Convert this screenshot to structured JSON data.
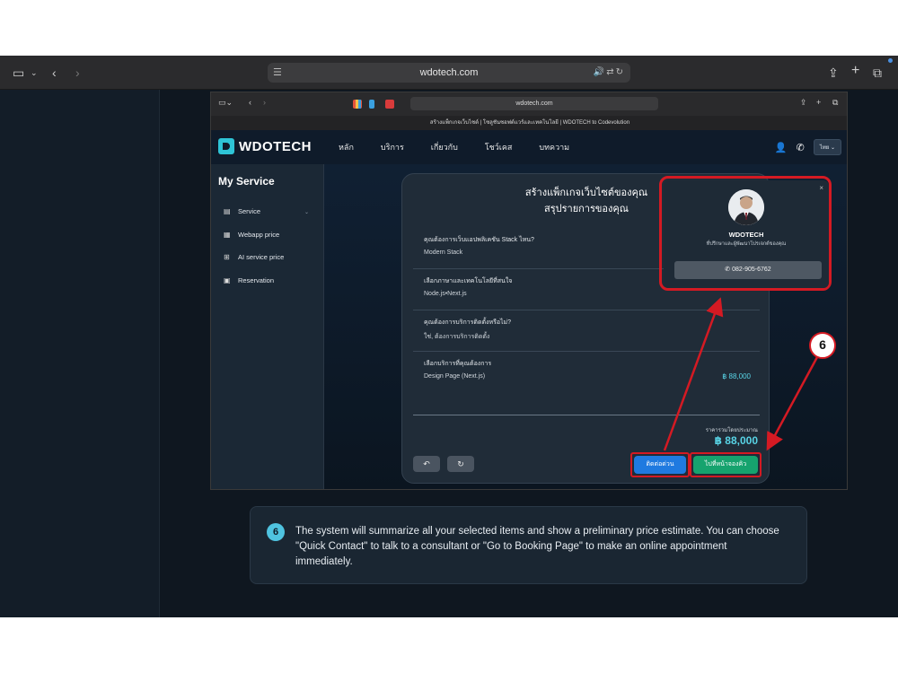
{
  "outer_browser": {
    "url": "wdotech.com"
  },
  "inner_browser": {
    "url": "wdotech.com",
    "tab_title": "สร้างแพ็กเกจเว็บไซต์ | โซลูชันซอฟต์แวร์และเทคโนโลยี | WDOTECH to Codevolution"
  },
  "site": {
    "logo_text": "WDOTECH",
    "nav": [
      "หลัก",
      "บริการ",
      "เกี่ยวกับ",
      "โชว์เคส",
      "บทความ"
    ],
    "lang": "ไทย ⌄"
  },
  "sidebar": {
    "title": "My Service",
    "items": [
      {
        "icon": "server-icon",
        "label": "Service"
      },
      {
        "icon": "document-icon",
        "label": "Webapp price"
      },
      {
        "icon": "chip-icon",
        "label": "AI service price"
      },
      {
        "icon": "calendar-icon",
        "label": "Reservation"
      }
    ]
  },
  "summary": {
    "title_line1": "สร้างแพ็กเกจเว็บไซต์ของคุณ",
    "title_line2": "สรุปรายการของคุณ",
    "rows": [
      {
        "question": "คุณต้องการเว็บแอปพลิเคชัน Stack ไหน?",
        "answer": "Modern Stack",
        "price": ""
      },
      {
        "question": "เลือกภาษาและเทคโนโลยีที่สนใจ",
        "answer": "Node.js•Next.js",
        "price": ""
      },
      {
        "question": "คุณต้องการบริการติดตั้งหรือไม่?",
        "answer": "ใช่, ต้องการบริการติดตั้ง",
        "price": ""
      },
      {
        "question": "เลือกบริการที่คุณต้องการ",
        "answer": "Design Page (Next.js)",
        "price": "฿ 88,000"
      }
    ],
    "total_label": "ราคารวมโดยประมาณ",
    "total_value": "฿ 88,000",
    "back_icon": "↶",
    "reset_icon": "↻",
    "contact_button": "ติดต่อด่วน",
    "booking_button": "ไปที่หน้าจองคิว"
  },
  "popup": {
    "name": "WDOTECH",
    "subtitle": "ที่ปรึกษาและผู้พัฒนาโปรเจกต์ของคุณ",
    "phone": "082-905-6762",
    "close": "×"
  },
  "step_badge": "6",
  "explanation": {
    "number": "6",
    "text": "The system will summarize all your selected items and show a preliminary price estimate. You can choose \"Quick Contact\" to talk to a consultant or \"Go to Booking Page\" to make an online appointment immediately."
  },
  "colors": {
    "accent": "#58d4e6",
    "highlight": "#d41a23",
    "contact": "#1f7ae0",
    "booking": "#16a36e"
  }
}
